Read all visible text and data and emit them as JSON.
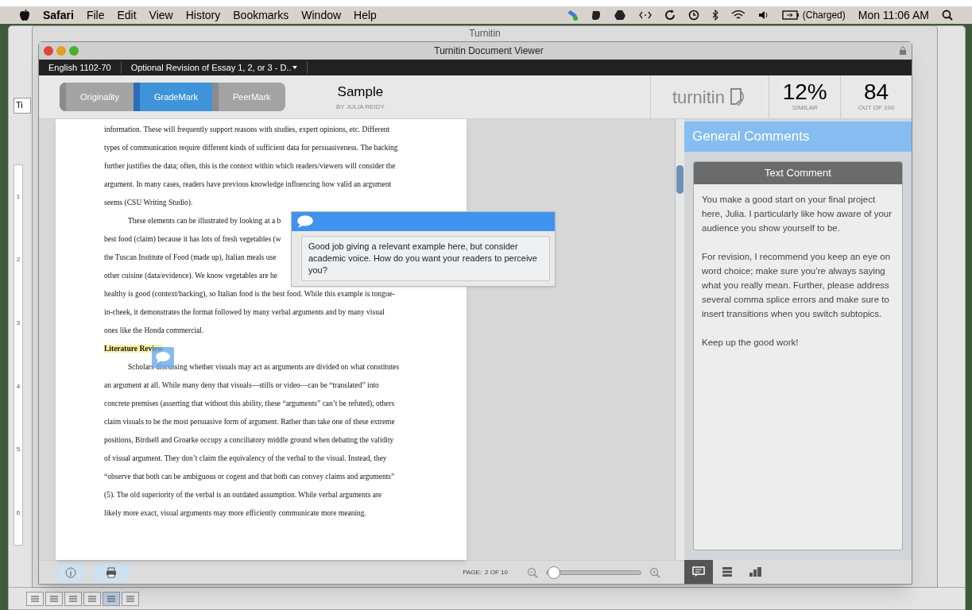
{
  "menu_bar": {
    "app_name": "Safari",
    "menus": [
      "File",
      "Edit",
      "View",
      "History",
      "Bookmarks",
      "Window",
      "Help"
    ],
    "battery": "(Charged)",
    "clock": "Mon 11:06 AM"
  },
  "back_window": {
    "title": "Turnitin",
    "field_value": "Ti",
    "ruler": [
      "1",
      "2",
      "3",
      "4",
      "5",
      "6"
    ]
  },
  "viewer": {
    "title": "Turnitin Document Viewer",
    "breadcrumbs": [
      "English 1102-70",
      "Optional Revision of Essay 1, 2, or 3 - D.."
    ],
    "modes": [
      {
        "label": "Originality",
        "selected": false
      },
      {
        "label": "GradeMark",
        "selected": true
      },
      {
        "label": "PeerMark",
        "selected": false
      }
    ],
    "paper": {
      "title": "Sample",
      "author": "BY JULIA REIDY"
    },
    "logo": "turnitin",
    "similarity": {
      "value": "12%",
      "label": "SIMILAR"
    },
    "grade": {
      "value": "84",
      "label": "OUT OF 100"
    },
    "document": [
      {
        "kind": "paragraph",
        "indent": false,
        "lines": [
          "information. These will frequently support reasons with studies, expert opinions, etc. Different",
          "types of communication require different kinds of sufficient data for persuasiveness. The backing",
          "further justifies the data; often, this is the context within which readers/viewers will consider the",
          "argument. In many cases, readers have previous knowledge influencing how valid an argument",
          "seems (CSU Writing Studio)."
        ]
      },
      {
        "kind": "paragraph",
        "indent": true,
        "lines": [
          "These elements can be illustrated by looking at a b",
          "best food (claim) because it has lots of fresh vegetables (w",
          "the Tuscan Institute of Food (made up), Italian meals use",
          "other cuisine (data/evidence). We know vegetables are he",
          "healthy is good (context/backing), so Italian food is the best food. While this example is tongue-",
          "in-cheek, it demonstrates the format followed by many verbal arguments and by many visual",
          "ones like the Honda commercial."
        ]
      },
      {
        "kind": "heading",
        "lines": [
          "Literature Review"
        ]
      },
      {
        "kind": "paragraph",
        "indent": true,
        "lines": [
          "Scholars discussing whether visuals may act as arguments are divided on what constitutes",
          "an argument at all. While many deny that visuals—stills or video—can be “translated” into",
          "concrete premises (asserting that without this ability, these “arguments” can’t be refuted), others",
          "claim visuals to be the most persuasive form of argument. Rather than take one of these extreme",
          "positions, Birdsell and Groarke occupy a conciliatory middle ground when debating the validity",
          "of visual argument. They don’t claim the equivalency of the verbal to the visual. Instead, they",
          "“observe that both can be ambiguous or cogent and that both can convey claims and arguments”",
          "(5). The old superiority of the verbal is an outdated assumption. While verbal arguments are",
          "likely more exact, visual arguments may more efficiently communicate more meaning."
        ]
      }
    ]
  },
  "popup_comment": "Good job giving a relevant example here, but consider academic voice. How do you want your readers to perceive you?",
  "panel": {
    "title": "General Comments",
    "card_title": "Text Comment",
    "paragraphs": [
      "You make a good start on your final project here, Julia. I particularly like how aware of your audience you show yourself to be.",
      "For revision, I recommend you keep an eye on word choice; make sure you’re always saying what you really mean. Further, please address several comma splice errors and make sure to insert transitions when you switch subtopics.",
      "Keep up the good work!"
    ]
  },
  "footer": {
    "page_label": "PAGE:",
    "page": "2 OF 10",
    "zoom": {
      "level": 0.02
    }
  },
  "side_tabs": [
    {
      "kind": "comments",
      "selected": true
    },
    {
      "kind": "list",
      "selected": false
    },
    {
      "kind": "grid",
      "selected": false
    }
  ]
}
